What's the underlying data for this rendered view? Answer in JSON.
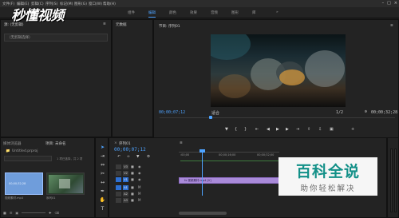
{
  "menubar": {
    "items": [
      "文件(F)",
      "编辑(E)",
      "剪辑(C)",
      "序列(S)",
      "标记(M)",
      "图形(G)",
      "窗口(W)",
      "帮助(H)"
    ],
    "window_controls": [
      "–",
      "□",
      "×"
    ]
  },
  "logo": {
    "text": "秒懂视频"
  },
  "workspace_tabs": {
    "items": [
      "组件",
      "编辑",
      "颜色",
      "效果",
      "音频",
      "图形",
      "库"
    ],
    "active_index": 1,
    "overflow": "»"
  },
  "source_panel": {
    "title": "源: (无剪辑)",
    "menu_glyph": "≡",
    "dropdown": "（无剪辑选择）"
  },
  "effects_panel": {
    "title": "元数据"
  },
  "program_panel": {
    "title": "节目: 序列01",
    "menu_glyph": "≡",
    "timecode": "00;00;07;12",
    "fit_label": "适合",
    "quality_label": "1/2",
    "duration": "00;00;32;28"
  },
  "project_panel": {
    "title": "项目: 未命名",
    "tab2": "媒体浏览器",
    "folder_name": "Untitled.prproj",
    "item_count": "1 项已选择，共 2 项",
    "item_search_placeholder": "",
    "items": [
      {
        "label": "视频素材.mp4",
        "thumb_text": "00;00;32;28"
      },
      {
        "label": "序列01",
        "thumb_text": ""
      }
    ]
  },
  "timeline": {
    "title": "序列01",
    "close_glyph": "×",
    "menu_glyph": "≡",
    "timecode": "00;00;07;12",
    "ruler_labels": [
      ":00;00",
      "00;00;16;00",
      "00;00;32;00"
    ],
    "tracks": [
      "V3",
      "V2",
      "V1",
      "A1",
      "A2",
      "A3"
    ],
    "clip_label": "fx 视频素材.mp4 [V]",
    "icons": {
      "track_lock": "lock-icon",
      "track_eye": "eye-icon"
    }
  },
  "watermark": {
    "line1": "百科全说",
    "line2": "助你轻松解决"
  },
  "colors": {
    "accent": "#4ea3ff",
    "clip": "#a98ad9",
    "watermark_green": "#129088"
  }
}
